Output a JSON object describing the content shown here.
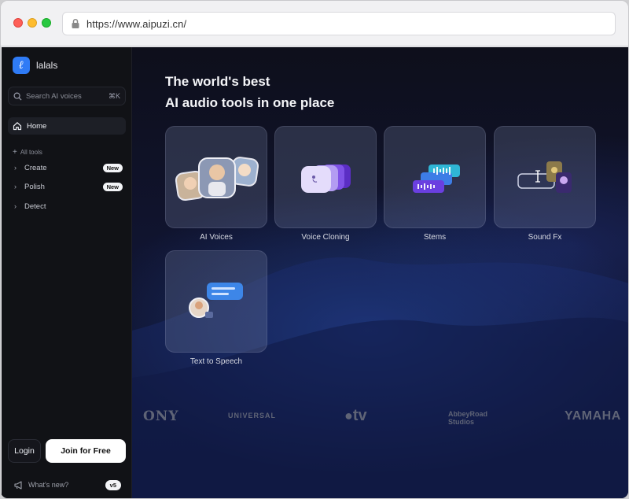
{
  "browser": {
    "url": "https://www.aipuzi.cn/"
  },
  "sidebar": {
    "logo_text": "lalals",
    "logo_mark": "ℓ",
    "search_placeholder": "Search AI voices",
    "search_shortcut": "⌘K",
    "home_label": "Home",
    "all_tools_label": "All tools",
    "items": [
      {
        "label": "Create",
        "badge": "New"
      },
      {
        "label": "Polish",
        "badge": "New"
      },
      {
        "label": "Detect",
        "badge": ""
      }
    ],
    "login_label": "Login",
    "join_label": "Join for Free",
    "whats_new_label": "What's new?",
    "version": "v5"
  },
  "main": {
    "headline_line1": "The world's best",
    "headline_line2": "AI audio tools in one place",
    "tools": [
      {
        "label": "AI Voices",
        "icon": "ai-voices-icon"
      },
      {
        "label": "Voice Cloning",
        "icon": "voice-cloning-icon"
      },
      {
        "label": "Stems",
        "icon": "stems-icon"
      },
      {
        "label": "Sound Fx",
        "icon": "sound-fx-icon"
      },
      {
        "label": "Text to Speech",
        "icon": "text-to-speech-icon"
      }
    ],
    "brands": [
      "ONY",
      "UNIVERSAL",
      "tv",
      "AbbeyRoad Studios",
      "YAMAHA"
    ]
  },
  "colors": {
    "accent": "#2f7bf6",
    "sidebar_bg": "#111216",
    "main_bg": "#0e0f1b"
  }
}
